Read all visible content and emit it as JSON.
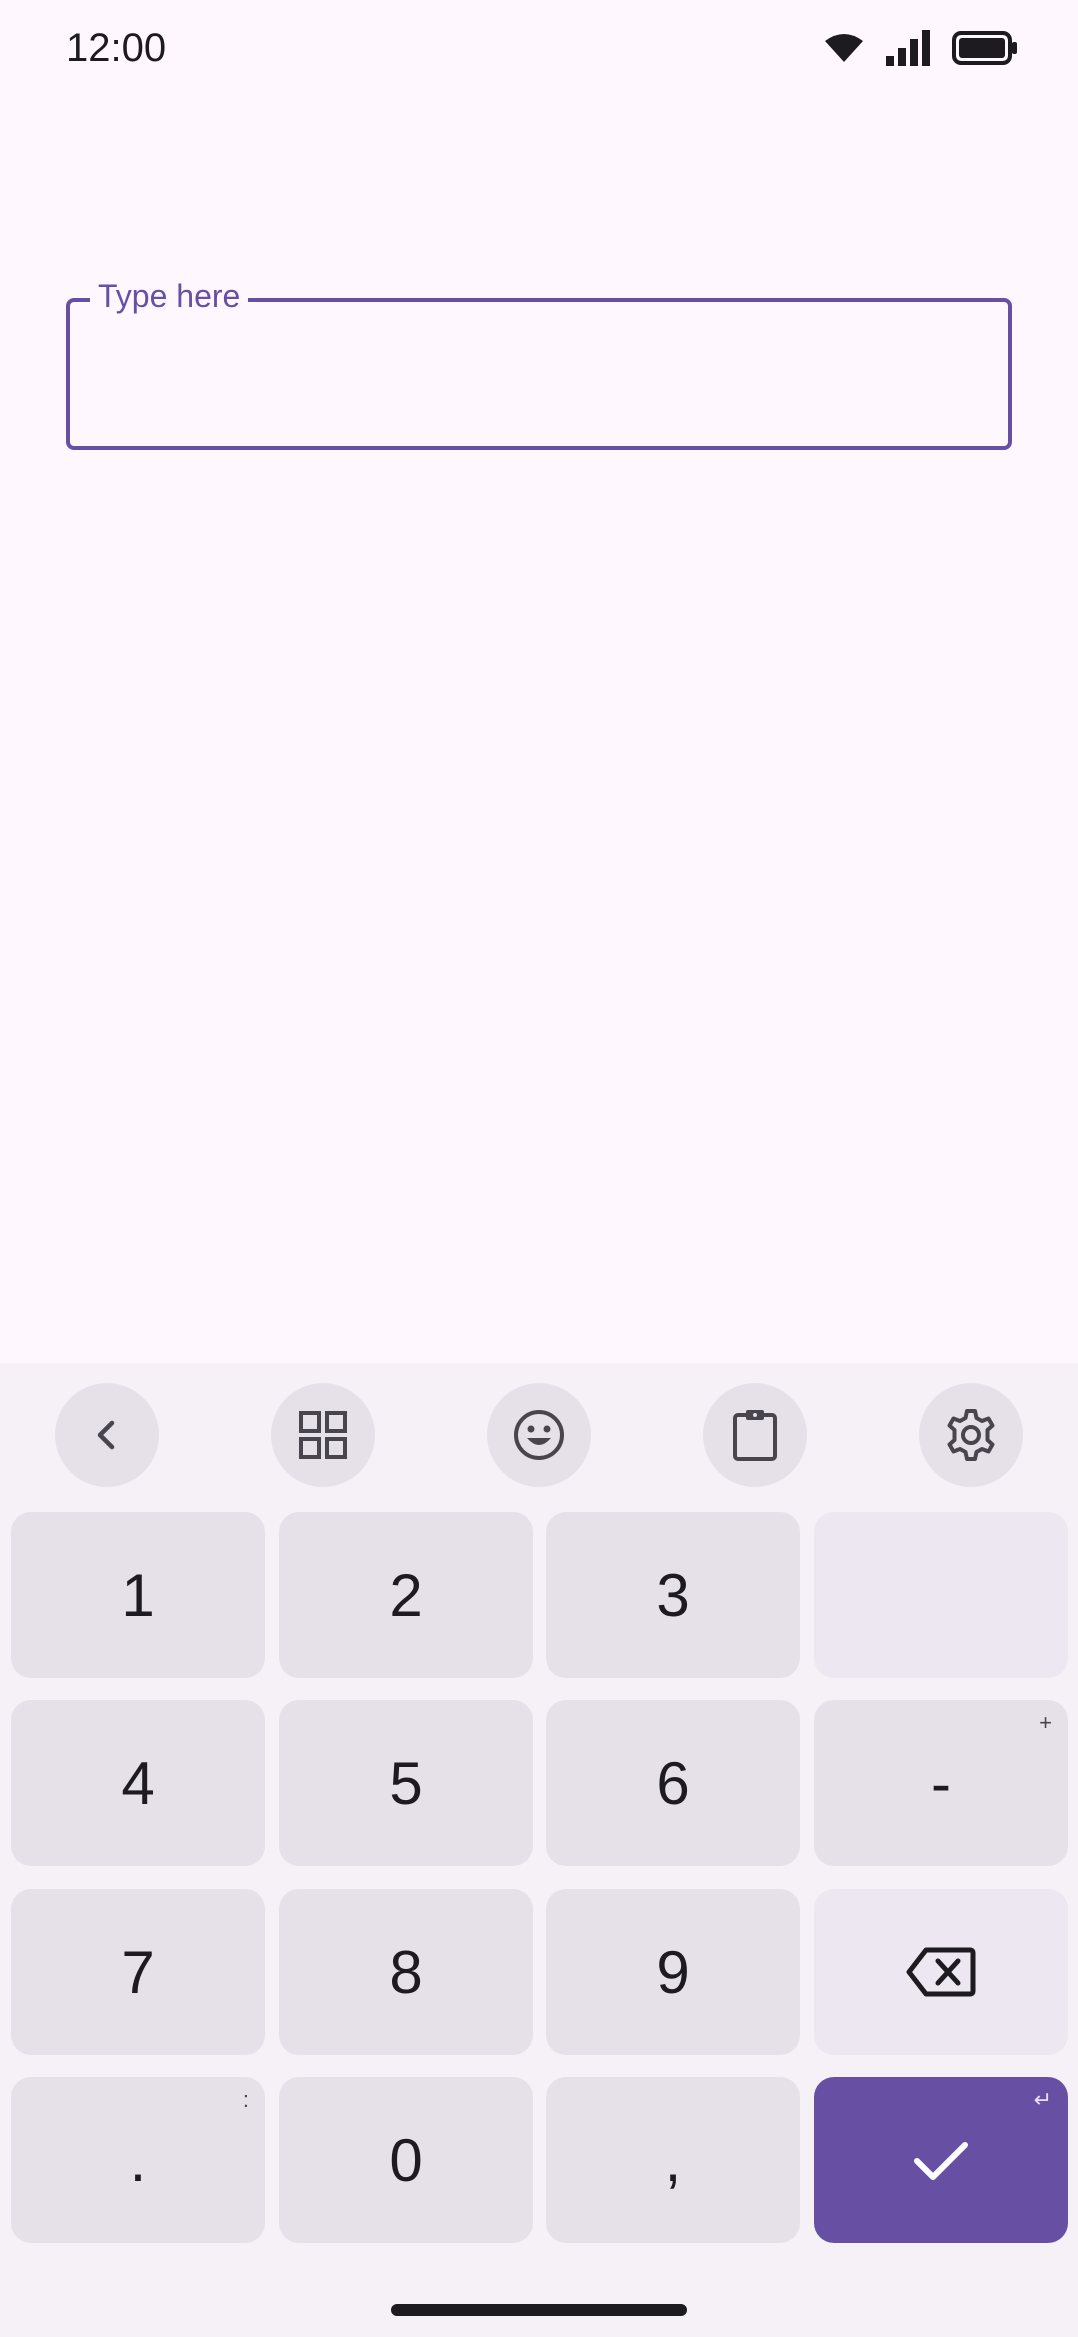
{
  "status_bar": {
    "time": "12:00",
    "icons": [
      "wifi-icon",
      "cellular-signal-icon",
      "battery-icon"
    ]
  },
  "text_field": {
    "label": "Type here",
    "value": "",
    "accent_color": "#6750a4"
  },
  "keyboard": {
    "toolbar": [
      "back-arrow-icon",
      "grid-icon",
      "emoji-icon",
      "clipboard-icon",
      "settings-gear-icon"
    ],
    "keys": {
      "k1": "1",
      "k2": "2",
      "k3": "3",
      "k4": "4",
      "k5": "5",
      "k6": "6",
      "k7": "7",
      "k8": "8",
      "k9": "9",
      "k0": "0",
      "minus": "-",
      "minus_hint": "+",
      "period": ".",
      "period_hint": ":",
      "comma": ",",
      "enter_hint": "↵"
    },
    "enter_color": "#6750a4"
  }
}
